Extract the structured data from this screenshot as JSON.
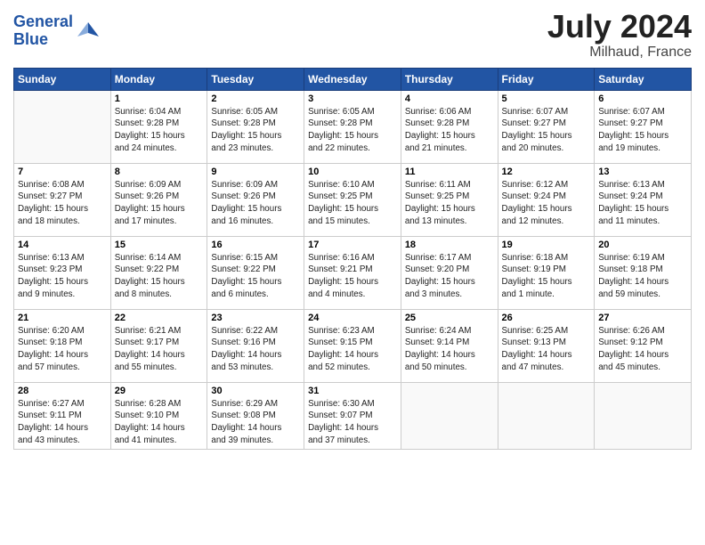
{
  "header": {
    "logo_line1": "General",
    "logo_line2": "Blue",
    "month": "July 2024",
    "location": "Milhaud, France"
  },
  "days_of_week": [
    "Sunday",
    "Monday",
    "Tuesday",
    "Wednesday",
    "Thursday",
    "Friday",
    "Saturday"
  ],
  "weeks": [
    [
      {
        "day": "",
        "info": ""
      },
      {
        "day": "1",
        "info": "Sunrise: 6:04 AM\nSunset: 9:28 PM\nDaylight: 15 hours\nand 24 minutes."
      },
      {
        "day": "2",
        "info": "Sunrise: 6:05 AM\nSunset: 9:28 PM\nDaylight: 15 hours\nand 23 minutes."
      },
      {
        "day": "3",
        "info": "Sunrise: 6:05 AM\nSunset: 9:28 PM\nDaylight: 15 hours\nand 22 minutes."
      },
      {
        "day": "4",
        "info": "Sunrise: 6:06 AM\nSunset: 9:28 PM\nDaylight: 15 hours\nand 21 minutes."
      },
      {
        "day": "5",
        "info": "Sunrise: 6:07 AM\nSunset: 9:27 PM\nDaylight: 15 hours\nand 20 minutes."
      },
      {
        "day": "6",
        "info": "Sunrise: 6:07 AM\nSunset: 9:27 PM\nDaylight: 15 hours\nand 19 minutes."
      }
    ],
    [
      {
        "day": "7",
        "info": "Sunrise: 6:08 AM\nSunset: 9:27 PM\nDaylight: 15 hours\nand 18 minutes."
      },
      {
        "day": "8",
        "info": "Sunrise: 6:09 AM\nSunset: 9:26 PM\nDaylight: 15 hours\nand 17 minutes."
      },
      {
        "day": "9",
        "info": "Sunrise: 6:09 AM\nSunset: 9:26 PM\nDaylight: 15 hours\nand 16 minutes."
      },
      {
        "day": "10",
        "info": "Sunrise: 6:10 AM\nSunset: 9:25 PM\nDaylight: 15 hours\nand 15 minutes."
      },
      {
        "day": "11",
        "info": "Sunrise: 6:11 AM\nSunset: 9:25 PM\nDaylight: 15 hours\nand 13 minutes."
      },
      {
        "day": "12",
        "info": "Sunrise: 6:12 AM\nSunset: 9:24 PM\nDaylight: 15 hours\nand 12 minutes."
      },
      {
        "day": "13",
        "info": "Sunrise: 6:13 AM\nSunset: 9:24 PM\nDaylight: 15 hours\nand 11 minutes."
      }
    ],
    [
      {
        "day": "14",
        "info": "Sunrise: 6:13 AM\nSunset: 9:23 PM\nDaylight: 15 hours\nand 9 minutes."
      },
      {
        "day": "15",
        "info": "Sunrise: 6:14 AM\nSunset: 9:22 PM\nDaylight: 15 hours\nand 8 minutes."
      },
      {
        "day": "16",
        "info": "Sunrise: 6:15 AM\nSunset: 9:22 PM\nDaylight: 15 hours\nand 6 minutes."
      },
      {
        "day": "17",
        "info": "Sunrise: 6:16 AM\nSunset: 9:21 PM\nDaylight: 15 hours\nand 4 minutes."
      },
      {
        "day": "18",
        "info": "Sunrise: 6:17 AM\nSunset: 9:20 PM\nDaylight: 15 hours\nand 3 minutes."
      },
      {
        "day": "19",
        "info": "Sunrise: 6:18 AM\nSunset: 9:19 PM\nDaylight: 15 hours\nand 1 minute."
      },
      {
        "day": "20",
        "info": "Sunrise: 6:19 AM\nSunset: 9:18 PM\nDaylight: 14 hours\nand 59 minutes."
      }
    ],
    [
      {
        "day": "21",
        "info": "Sunrise: 6:20 AM\nSunset: 9:18 PM\nDaylight: 14 hours\nand 57 minutes."
      },
      {
        "day": "22",
        "info": "Sunrise: 6:21 AM\nSunset: 9:17 PM\nDaylight: 14 hours\nand 55 minutes."
      },
      {
        "day": "23",
        "info": "Sunrise: 6:22 AM\nSunset: 9:16 PM\nDaylight: 14 hours\nand 53 minutes."
      },
      {
        "day": "24",
        "info": "Sunrise: 6:23 AM\nSunset: 9:15 PM\nDaylight: 14 hours\nand 52 minutes."
      },
      {
        "day": "25",
        "info": "Sunrise: 6:24 AM\nSunset: 9:14 PM\nDaylight: 14 hours\nand 50 minutes."
      },
      {
        "day": "26",
        "info": "Sunrise: 6:25 AM\nSunset: 9:13 PM\nDaylight: 14 hours\nand 47 minutes."
      },
      {
        "day": "27",
        "info": "Sunrise: 6:26 AM\nSunset: 9:12 PM\nDaylight: 14 hours\nand 45 minutes."
      }
    ],
    [
      {
        "day": "28",
        "info": "Sunrise: 6:27 AM\nSunset: 9:11 PM\nDaylight: 14 hours\nand 43 minutes."
      },
      {
        "day": "29",
        "info": "Sunrise: 6:28 AM\nSunset: 9:10 PM\nDaylight: 14 hours\nand 41 minutes."
      },
      {
        "day": "30",
        "info": "Sunrise: 6:29 AM\nSunset: 9:08 PM\nDaylight: 14 hours\nand 39 minutes."
      },
      {
        "day": "31",
        "info": "Sunrise: 6:30 AM\nSunset: 9:07 PM\nDaylight: 14 hours\nand 37 minutes."
      },
      {
        "day": "",
        "info": ""
      },
      {
        "day": "",
        "info": ""
      },
      {
        "day": "",
        "info": ""
      }
    ]
  ]
}
